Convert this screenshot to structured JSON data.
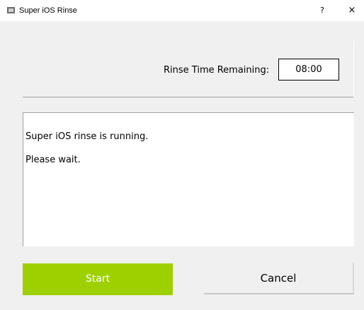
{
  "window": {
    "title": "Super iOS Rinse",
    "help_label": "?",
    "close_label": "×",
    "icon": "app-icon"
  },
  "timer": {
    "label": "Rinse Time Remaining:",
    "value": "08:00"
  },
  "status": {
    "line1": "Super iOS rinse is running.",
    "line2": "Please wait."
  },
  "buttons": {
    "start_label": "Start",
    "cancel_label": "Cancel"
  },
  "colors": {
    "start_button_bg": "#9ed000",
    "start_button_text": "#ffffff"
  }
}
